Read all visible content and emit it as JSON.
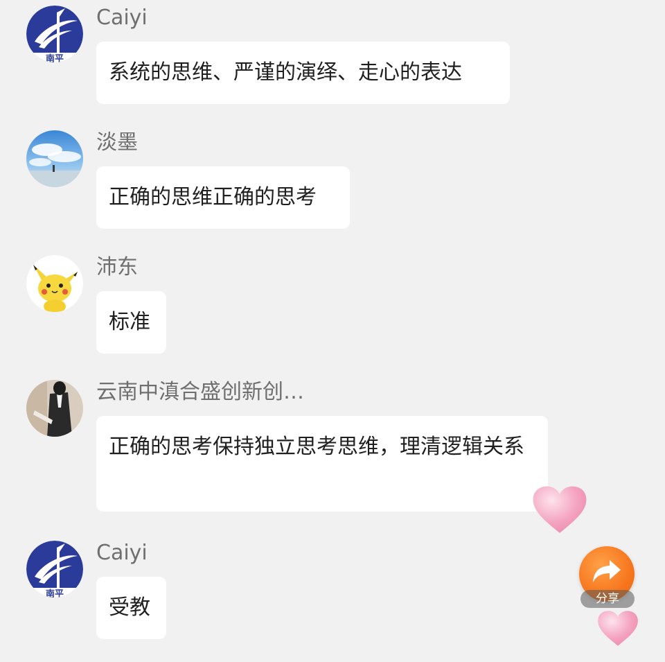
{
  "messages": [
    {
      "sender": "Caiyi",
      "text": "系统的思维、严谨的演绎、走心的表达",
      "avatar": "logo-avatar"
    },
    {
      "sender": "淡墨",
      "text": "正确的思维正确的思考",
      "avatar": "sky-avatar"
    },
    {
      "sender": "沛东",
      "text": "标准",
      "avatar": "pikachu-avatar"
    },
    {
      "sender": "云南中滇合盛创新创…",
      "text": "正确的思考保持独立思考思维，理清逻辑关系",
      "avatar": "person-avatar"
    },
    {
      "sender": "Caiyi",
      "text": "受教",
      "avatar": "logo-avatar"
    }
  ],
  "logo_text": "南平",
  "share": {
    "label": "分享",
    "icon": "share-arrow-icon"
  },
  "colors": {
    "background": "#f1f1f1",
    "bubble": "#ffffff",
    "name_text": "#6f6f6f",
    "message_text": "#1f1f1f",
    "share_button": "#f7761d",
    "heart": "#f4a3c0"
  }
}
